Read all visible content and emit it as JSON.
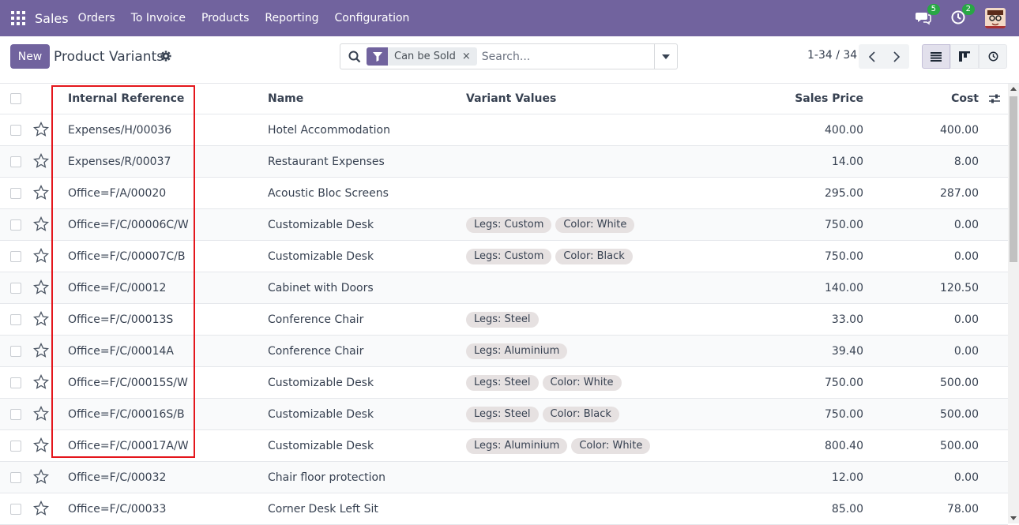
{
  "navbar": {
    "app_name": "Sales",
    "menu": [
      "Orders",
      "To Invoice",
      "Products",
      "Reporting",
      "Configuration"
    ],
    "messages_badge": "5",
    "activities_badge": "2",
    "bg_color": "#71639e"
  },
  "control": {
    "new_label": "New",
    "title": "Product Variants",
    "filter_facet": "Can be Sold",
    "search_placeholder": "Search...",
    "pager": "1-34 / 34"
  },
  "table": {
    "headers": {
      "ref": "Internal Reference",
      "name": "Name",
      "variants": "Variant Values",
      "price": "Sales Price",
      "cost": "Cost"
    },
    "rows": [
      {
        "ref": "Expenses/H/00036",
        "name": "Hotel Accommodation",
        "tags": [],
        "price": "400.00",
        "cost": "400.00"
      },
      {
        "ref": "Expenses/R/00037",
        "name": "Restaurant Expenses",
        "tags": [],
        "price": "14.00",
        "cost": "8.00"
      },
      {
        "ref": "Office=F/A/00020",
        "name": "Acoustic Bloc Screens",
        "tags": [],
        "price": "295.00",
        "cost": "287.00"
      },
      {
        "ref": "Office=F/C/00006C/W",
        "name": "Customizable Desk",
        "tags": [
          "Legs: Custom",
          "Color: White"
        ],
        "price": "750.00",
        "cost": "0.00"
      },
      {
        "ref": "Office=F/C/00007C/B",
        "name": "Customizable Desk",
        "tags": [
          "Legs: Custom",
          "Color: Black"
        ],
        "price": "750.00",
        "cost": "0.00"
      },
      {
        "ref": "Office=F/C/00012",
        "name": "Cabinet with Doors",
        "tags": [],
        "price": "140.00",
        "cost": "120.50"
      },
      {
        "ref": "Office=F/C/00013S",
        "name": "Conference Chair",
        "tags": [
          "Legs: Steel"
        ],
        "price": "33.00",
        "cost": "0.00"
      },
      {
        "ref": "Office=F/C/00014A",
        "name": "Conference Chair",
        "tags": [
          "Legs: Aluminium"
        ],
        "price": "39.40",
        "cost": "0.00"
      },
      {
        "ref": "Office=F/C/00015S/W",
        "name": "Customizable Desk",
        "tags": [
          "Legs: Steel",
          "Color: White"
        ],
        "price": "750.00",
        "cost": "500.00"
      },
      {
        "ref": "Office=F/C/00016S/B",
        "name": "Customizable Desk",
        "tags": [
          "Legs: Steel",
          "Color: Black"
        ],
        "price": "750.00",
        "cost": "500.00"
      },
      {
        "ref": "Office=F/C/00017A/W",
        "name": "Customizable Desk",
        "tags": [
          "Legs: Aluminium",
          "Color: White"
        ],
        "price": "800.40",
        "cost": "500.00"
      },
      {
        "ref": "Office=F/C/00032",
        "name": "Chair floor protection",
        "tags": [],
        "price": "12.00",
        "cost": "0.00"
      },
      {
        "ref": "Office=F/C/00033",
        "name": "Corner Desk Left Sit",
        "tags": [],
        "price": "85.00",
        "cost": "78.00"
      }
    ]
  },
  "highlight_color": "#e4161c"
}
